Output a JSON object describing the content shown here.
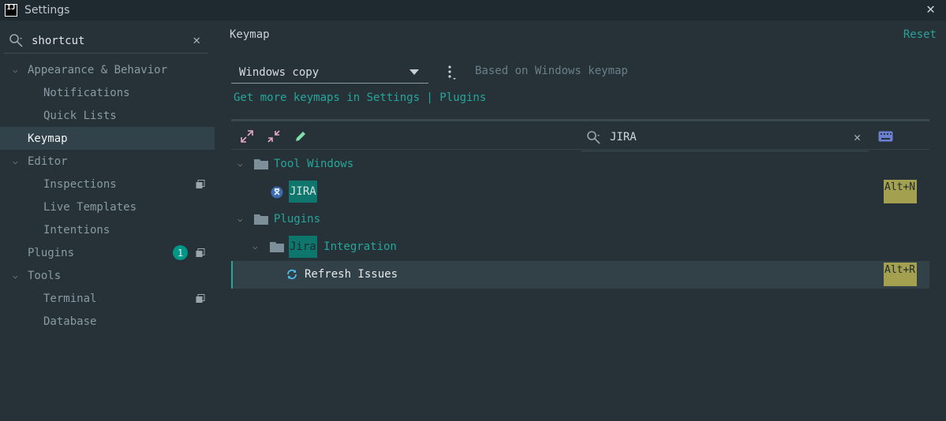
{
  "window": {
    "title": "Settings",
    "logo_text": "IJ"
  },
  "sidebar": {
    "search": {
      "value": "shortcut"
    },
    "items": [
      {
        "label": "Appearance & Behavior",
        "level": 0,
        "expanded": true
      },
      {
        "label": "Notifications",
        "level": 1
      },
      {
        "label": "Quick Lists",
        "level": 1
      },
      {
        "label": "Keymap",
        "level": 0,
        "selected": true
      },
      {
        "label": "Editor",
        "level": 0,
        "expanded": true
      },
      {
        "label": "Inspections",
        "level": 1,
        "copy_icon": true
      },
      {
        "label": "Live Templates",
        "level": 1
      },
      {
        "label": "Intentions",
        "level": 1
      },
      {
        "label": "Plugins",
        "level": 0,
        "badge": "1",
        "copy_icon": true
      },
      {
        "label": "Tools",
        "level": 0,
        "expanded": true
      },
      {
        "label": "Terminal",
        "level": 1,
        "copy_icon": true
      },
      {
        "label": "Database",
        "level": 1
      }
    ]
  },
  "main": {
    "title": "Keymap",
    "reset_label": "Reset",
    "keymap_select": {
      "value": "Windows copy"
    },
    "based_on": "Based on Windows keymap",
    "more_keymaps_link": "Get more keymaps in Settings | Plugins",
    "filter": {
      "value": "JIRA"
    },
    "tree": {
      "tool_windows": "Tool Windows",
      "jira": "JIRA",
      "jira_shortcut": "Alt+N",
      "plugins": "Plugins",
      "jira_integration_prefix": "Jira",
      "jira_integration_suffix": " Integration",
      "refresh_issues": "Refresh Issues",
      "refresh_shortcut": "Alt+R"
    }
  },
  "colors": {
    "accent": "#26a69a",
    "background": "#263238",
    "shortcut_bg": "#a3a050"
  }
}
